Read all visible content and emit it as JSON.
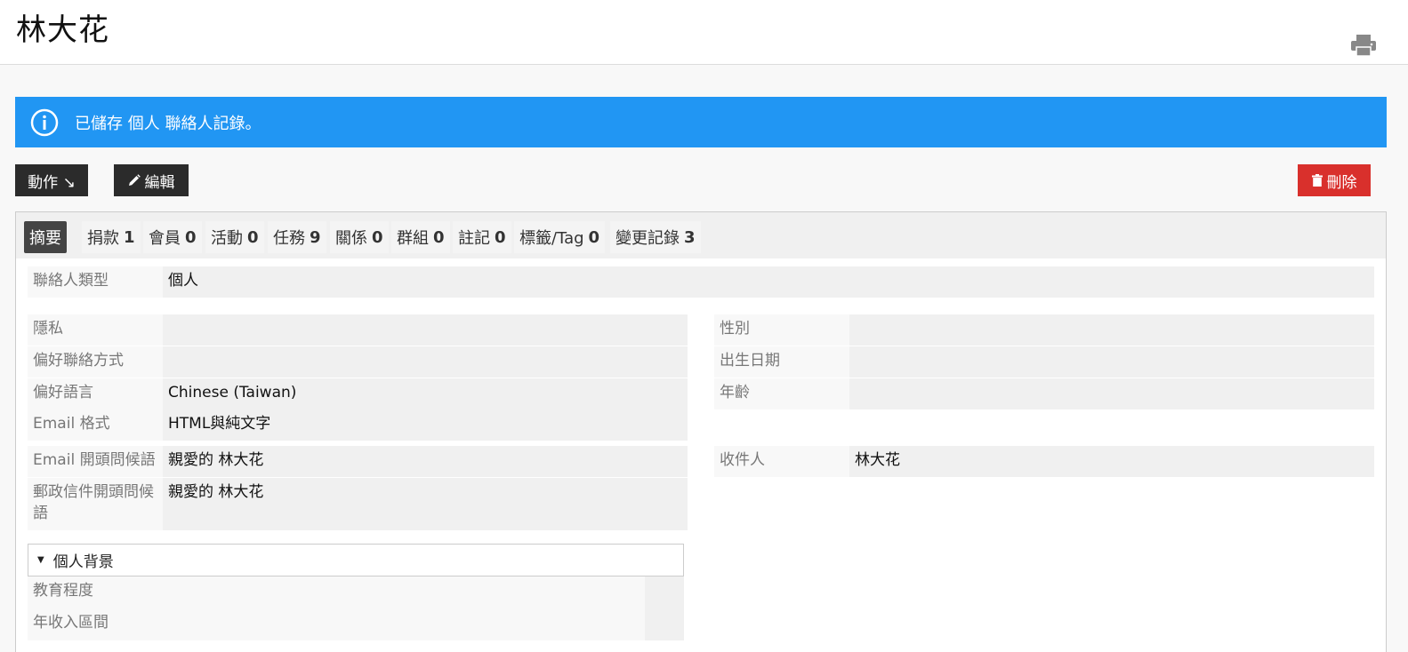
{
  "header": {
    "title": "林大花"
  },
  "alert": {
    "message": "已儲存 個人 聯絡人記錄。"
  },
  "toolbar": {
    "action_label": "動作 ↘",
    "edit_label": "編輯",
    "delete_label": "刪除"
  },
  "tabs": [
    {
      "label": "摘要",
      "count": ""
    },
    {
      "label": "捐款",
      "count": "1"
    },
    {
      "label": "會員",
      "count": "0"
    },
    {
      "label": "活動",
      "count": "0"
    },
    {
      "label": "任務",
      "count": "9"
    },
    {
      "label": "關係",
      "count": "0"
    },
    {
      "label": "群組",
      "count": "0"
    },
    {
      "label": "註記",
      "count": "0"
    },
    {
      "label": "標籤/Tag",
      "count": "0"
    },
    {
      "label": "變更記錄",
      "count": "3"
    }
  ],
  "contact_type": {
    "label": "聯絡人類型",
    "value": "個人"
  },
  "left_fields": [
    {
      "label": "隱私",
      "value": ""
    },
    {
      "label": "偏好聯絡方式",
      "value": ""
    },
    {
      "label": "偏好語言",
      "value": "Chinese (Taiwan)"
    },
    {
      "label": "Email 格式",
      "value": "HTML與純文字"
    },
    {
      "label": "Email 開頭問候語",
      "value": "親愛的 林大花"
    },
    {
      "label": "郵政信件開頭問候語",
      "value": "親愛的 林大花"
    }
  ],
  "right_fields": [
    {
      "label": "性別",
      "value": ""
    },
    {
      "label": "出生日期",
      "value": ""
    },
    {
      "label": "年齡",
      "value": ""
    },
    {
      "label": "收件人",
      "value": "林大花"
    }
  ],
  "background_section": {
    "title": "個人背景",
    "fields": [
      {
        "label": "教育程度",
        "value": ""
      },
      {
        "label": "年收入區間",
        "value": ""
      }
    ]
  },
  "colors": {
    "alert": "#2196f3",
    "delete": "#d9302c",
    "dark_button": "#2b2b2b"
  }
}
